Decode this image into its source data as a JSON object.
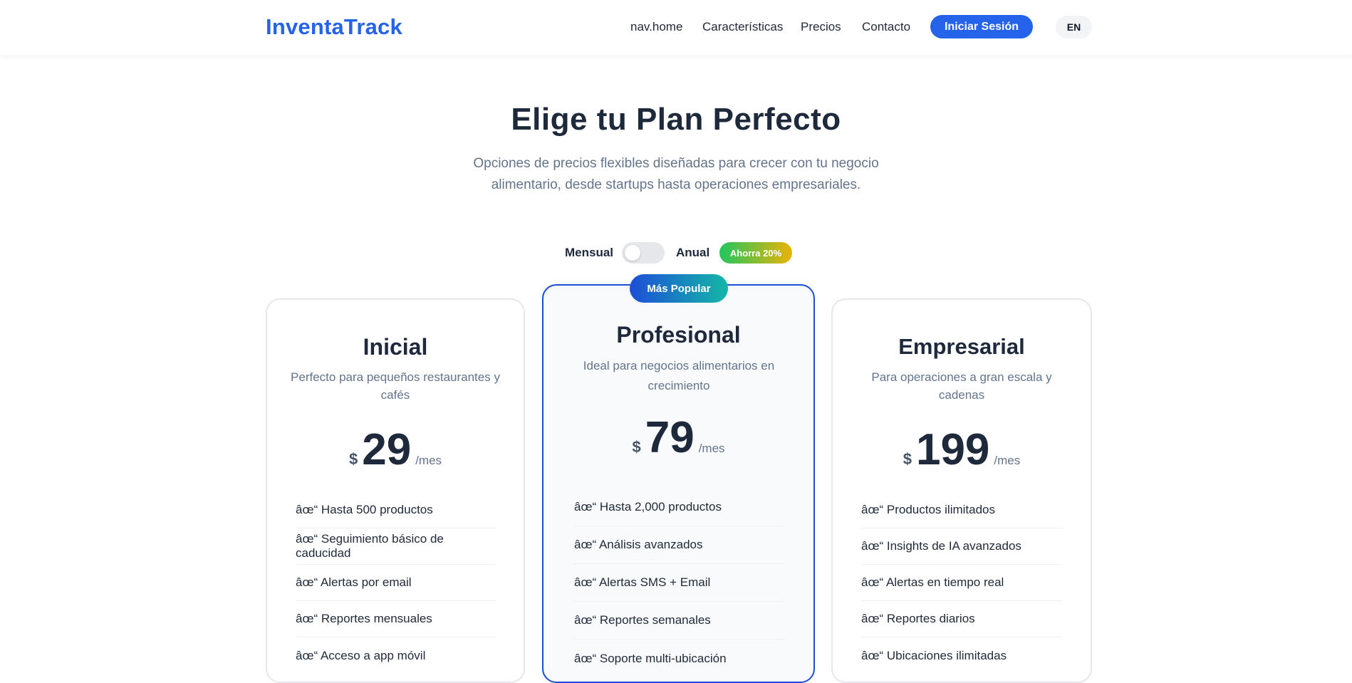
{
  "header": {
    "logo": "InventaTrack",
    "nav": [
      "nav.home",
      "Características",
      "Precios",
      "Contacto"
    ],
    "login_label": "Iniciar Sesión",
    "lang_label": "EN"
  },
  "hero": {
    "title": "Elige tu Plan Perfecto",
    "subtitle": "Opciones de precios flexibles diseñadas para crecer con tu negocio alimentario, desde startups hasta operaciones empresariales."
  },
  "billing": {
    "monthly_label": "Mensual",
    "annual_label": "Anual",
    "save_badge": "Ahorra 20%",
    "annual_selected": false
  },
  "plans": [
    {
      "name": "Inicial",
      "description": "Perfecto para pequeños restaurantes y cafés",
      "currency": "$",
      "price": "29",
      "period": "/mes",
      "features": [
        "âœ“ Hasta 500 productos",
        "âœ“ Seguimiento básico de caducidad",
        "âœ“ Alertas por email",
        "âœ“ Reportes mensuales",
        "âœ“ Acceso a app móvil"
      ]
    },
    {
      "name": "Profesional",
      "badge": "Más Popular",
      "description": "Ideal para negocios alimentarios en crecimiento",
      "currency": "$",
      "price": "79",
      "period": "/mes",
      "features": [
        "âœ“ Hasta 2,000 productos",
        "âœ“ Análisis avanzados",
        "âœ“ Alertas SMS + Email",
        "âœ“ Reportes semanales",
        "âœ“ Soporte multi-ubicación"
      ]
    },
    {
      "name": "Empresarial",
      "description": "Para operaciones a gran escala y cadenas",
      "currency": "$",
      "price": "199",
      "period": "/mes",
      "features": [
        "âœ“ Productos ilimitados",
        "âœ“ Insights de IA avanzados",
        "âœ“ Alertas en tiempo real",
        "âœ“ Reportes diarios",
        "âœ“ Ubicaciones ilimitadas"
      ]
    }
  ],
  "colors": {
    "brand": "#2563eb",
    "text_dark": "#1e293b",
    "text_muted": "#64748b",
    "featured_border": "#1d4ed8"
  }
}
